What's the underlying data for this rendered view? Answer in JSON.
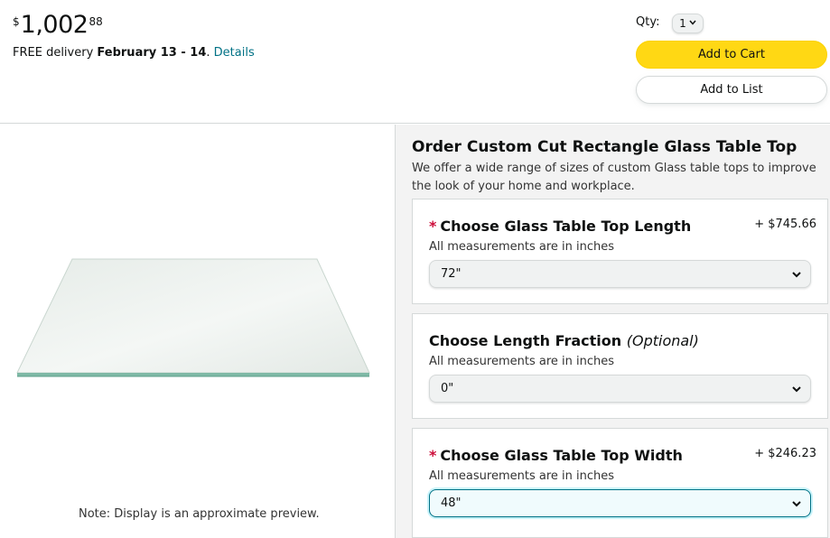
{
  "buybox": {
    "price_symbol": "$",
    "price_whole": "1,002",
    "price_fraction": "88",
    "delivery_prefix": "FREE delivery",
    "delivery_date": "February 13 - 14",
    "delivery_period": ".",
    "details_link": "Details",
    "qty_label": "Qty:",
    "qty_value": "1",
    "add_to_cart": "Add to Cart",
    "add_to_list": "Add to List"
  },
  "preview": {
    "note": "Note: Display is an approximate preview."
  },
  "config": {
    "title": "Order Custom Cut Rectangle Glass Table Top",
    "description": "We offer a wide range of sizes of custom Glass table tops to improve the look of your home and workplace.",
    "options": [
      {
        "required_mark": "*",
        "label": "Choose Glass Table Top Length",
        "price": "+ $745.66",
        "hint": "All measurements are in inches",
        "value": "72\""
      },
      {
        "label": "Choose Length Fraction",
        "optional": "(Optional)",
        "hint": "All measurements are in inches",
        "value": "0\""
      },
      {
        "required_mark": "*",
        "label": "Choose Glass Table Top Width",
        "price": "+ $246.23",
        "hint": "All measurements are in inches",
        "value": "48\""
      }
    ]
  },
  "colors": {
    "cart_button": "#ffd814",
    "link": "#007185",
    "required": "#cc0c39"
  }
}
